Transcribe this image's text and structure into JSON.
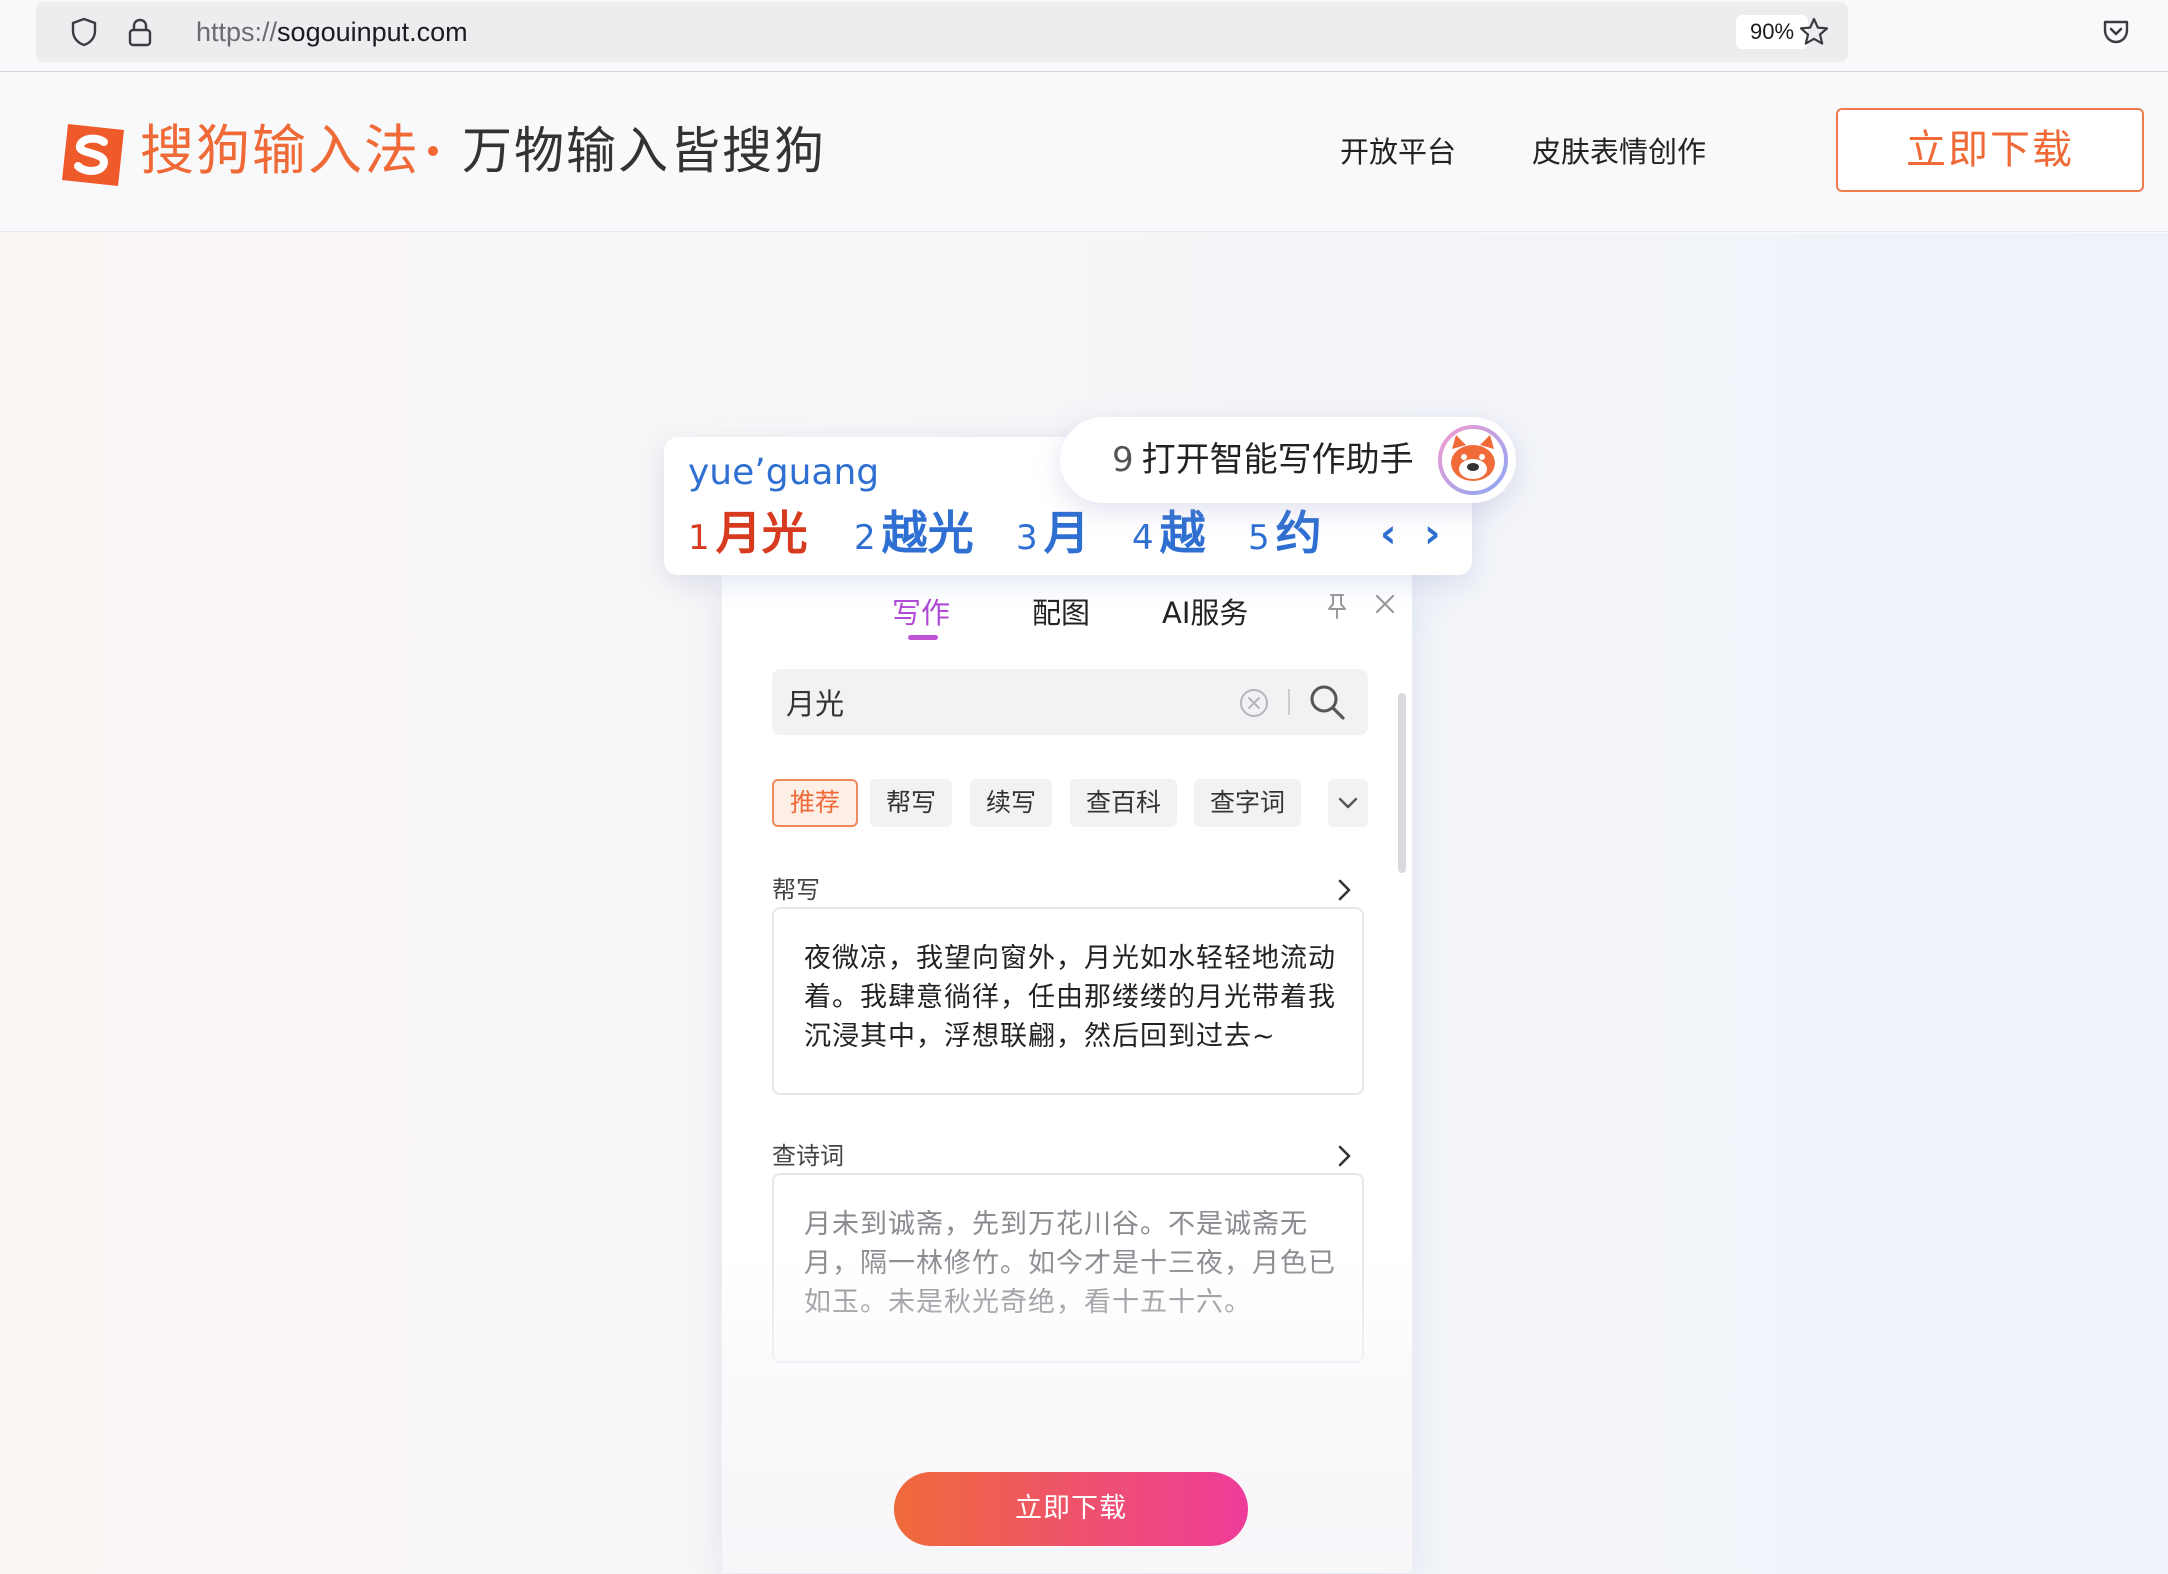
{
  "browser": {
    "url_scheme": "https://",
    "url_host": "sogouinput.com",
    "zoom": "90%"
  },
  "header": {
    "brand_name": "搜狗输入法",
    "slogan": "万物输入皆搜狗",
    "nav": [
      "开放平台",
      "皮肤表情创作"
    ],
    "download_label": "立即下载",
    "brand_color": "#ef6a37"
  },
  "ime": {
    "pinyin": "yue’guang",
    "candidates": [
      {
        "num": "1",
        "word": "月光"
      },
      {
        "num": "2",
        "word": "越光"
      },
      {
        "num": "3",
        "word": "月"
      },
      {
        "num": "4",
        "word": "越"
      },
      {
        "num": "5",
        "word": "约"
      }
    ],
    "prev_arrow": "‹",
    "next_arrow": "›",
    "assistant_num": "9",
    "assistant_label": "打开智能写作助手"
  },
  "panel": {
    "tabs": [
      "写作",
      "配图",
      "AI服务"
    ],
    "active_tab": "写作",
    "search_value": "月光",
    "chips": [
      "推荐",
      "帮写",
      "续写",
      "查百科",
      "查字词"
    ],
    "sections": [
      {
        "title": "帮写",
        "text": "夜微凉，我望向窗外，月光如水轻轻地流动着。我肆意徜徉，任由那缕缕的月光带着我沉浸其中，浮想联翩，然后回到过去~"
      },
      {
        "title": "查诗词",
        "text": "月未到诚斋，先到万花川谷。不是诚斋无月，隔一林修竹。如今才是十三夜，月色已如玉。未是秋光奇绝，看十五十六。"
      }
    ]
  },
  "cta": {
    "label": "立即下载"
  }
}
